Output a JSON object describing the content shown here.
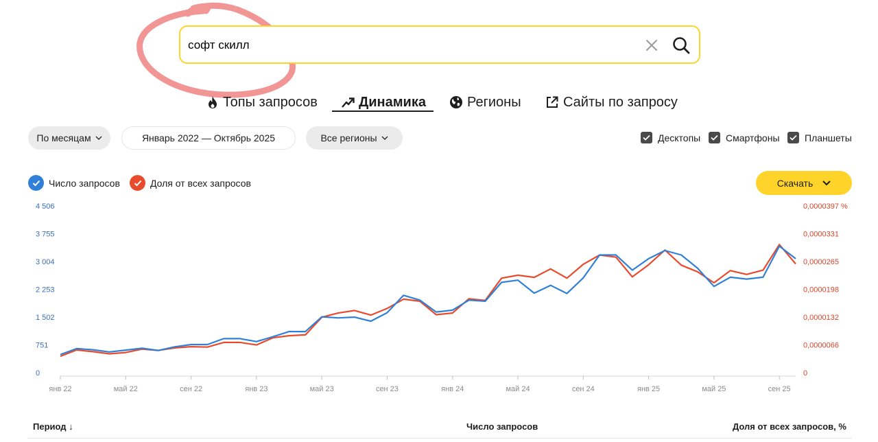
{
  "search": {
    "value": "софт скилл"
  },
  "tabs": [
    {
      "label": "Топы запросов",
      "active": false,
      "icon": "fire-icon"
    },
    {
      "label": "Динамика",
      "active": true,
      "icon": "trend-arrow-icon"
    },
    {
      "label": "Регионы",
      "active": false,
      "icon": "globe-icon"
    },
    {
      "label": "Сайты по запросу",
      "active": false,
      "icon": "external-link-icon"
    }
  ],
  "filters": {
    "period_group": "По месяцам",
    "date_range": "Январь 2022 — Октябрь 2025",
    "region": "Все регионы"
  },
  "devices": [
    {
      "label": "Десктопы",
      "checked": true
    },
    {
      "label": "Смартфоны",
      "checked": true
    },
    {
      "label": "Планшеты",
      "checked": true
    }
  ],
  "legend": [
    {
      "label": "Число запросов",
      "color": "#2f80d6"
    },
    {
      "label": "Доля от всех запросов",
      "color": "#e84a2c"
    }
  ],
  "download_label": "Скачать",
  "colors": {
    "accent": "#fed42b",
    "count": "#2f80d6",
    "share": "#e84a2c",
    "annotation": "#f08a8a"
  },
  "chart_data": {
    "type": "line",
    "x_labels": [
      "янв 22",
      "май 22",
      "сен 22",
      "янв 23",
      "май 23",
      "сен 23",
      "янв 24",
      "май 24",
      "сен 24",
      "янв 25",
      "май 25",
      "сен 25"
    ],
    "x": [
      "2022-01",
      "2022-02",
      "2022-03",
      "2022-04",
      "2022-05",
      "2022-06",
      "2022-07",
      "2022-08",
      "2022-09",
      "2022-10",
      "2022-11",
      "2022-12",
      "2023-01",
      "2023-02",
      "2023-03",
      "2023-04",
      "2023-05",
      "2023-06",
      "2023-07",
      "2023-08",
      "2023-09",
      "2023-10",
      "2023-11",
      "2023-12",
      "2024-01",
      "2024-02",
      "2024-03",
      "2024-04",
      "2024-05",
      "2024-06",
      "2024-07",
      "2024-08",
      "2024-09",
      "2024-10",
      "2024-11",
      "2024-12",
      "2025-01",
      "2025-02",
      "2025-03",
      "2025-04",
      "2025-05",
      "2025-06",
      "2025-07",
      "2025-08",
      "2025-09",
      "2025-10"
    ],
    "y_left_ticks": [
      "0",
      "751",
      "1 502",
      "2 253",
      "3 004",
      "3 755",
      "4 506"
    ],
    "y_right_ticks": [
      "0",
      "0,0000066",
      "0,0000132",
      "0,0000198",
      "0,0000265",
      "0,0000331",
      "0,0000397 %"
    ],
    "ylim_left": [
      0,
      4506
    ],
    "ylim_right": [
      0,
      3.97e-05
    ],
    "series": [
      {
        "name": "Число запросов",
        "axis": "left",
        "values": [
          490,
          650,
          620,
          560,
          610,
          660,
          600,
          700,
          760,
          760,
          920,
          920,
          840,
          970,
          1110,
          1110,
          1510,
          1480,
          1500,
          1390,
          1620,
          2090,
          1960,
          1640,
          1690,
          1960,
          1930,
          2440,
          2500,
          2150,
          2360,
          2140,
          2560,
          3180,
          3180,
          2770,
          3080,
          3300,
          3180,
          2820,
          2330,
          2580,
          2530,
          2580,
          3420,
          3080
        ],
        "color": "#2f80d6"
      },
      {
        "name": "Доля от всех запросов",
        "axis": "right",
        "values": [
          3.9e-06,
          5.4e-06,
          5e-06,
          4.5e-06,
          4.8e-06,
          5.6e-06,
          5.3e-06,
          5.9e-06,
          6.2e-06,
          6.1e-06,
          7.2e-06,
          7.2e-06,
          6.6e-06,
          8.3e-06,
          8.8e-06,
          9e-06,
          1.32e-05,
          1.42e-05,
          1.48e-05,
          1.37e-05,
          1.53e-05,
          1.75e-05,
          1.7e-05,
          1.38e-05,
          1.42e-05,
          1.76e-05,
          1.72e-05,
          2.25e-05,
          2.32e-05,
          2.27e-05,
          2.47e-05,
          2.25e-05,
          2.58e-05,
          2.8e-05,
          2.75e-05,
          2.28e-05,
          2.57e-05,
          2.92e-05,
          2.56e-05,
          2.4e-05,
          2.14e-05,
          2.43e-05,
          2.34e-05,
          2.44e-05,
          3.05e-05,
          2.59e-05
        ],
        "color": "#e84a2c"
      }
    ],
    "grid": false
  },
  "table": {
    "columns": [
      "Период",
      "Число запросов",
      "Доля от всех запросов, %"
    ],
    "sort_icon": "arrow-down-icon"
  }
}
